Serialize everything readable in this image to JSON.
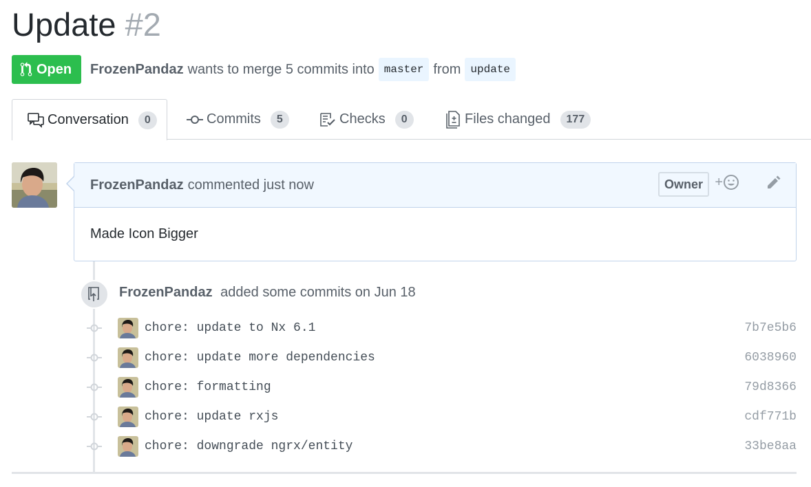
{
  "pr": {
    "title": "Update",
    "number": "#2",
    "state": "Open",
    "author": "FrozenPandaz",
    "wants_to_merge_text": "wants to merge 5 commits into",
    "base_branch": "master",
    "from_text": "from",
    "head_branch": "update"
  },
  "tabs": [
    {
      "label": "Conversation",
      "count": "0",
      "icon": "comment-discussion-icon"
    },
    {
      "label": "Commits",
      "count": "5",
      "icon": "git-commit-icon"
    },
    {
      "label": "Checks",
      "count": "0",
      "icon": "checklist-icon"
    },
    {
      "label": "Files changed",
      "count": "177",
      "icon": "file-diff-icon"
    }
  ],
  "comment": {
    "author": "FrozenPandaz",
    "action_text": "commented just now",
    "role_badge": "Owner",
    "reaction_plus": "+",
    "body": "Made Icon Bigger"
  },
  "commits_event": {
    "author": "FrozenPandaz",
    "text": "added some commits on Jun 18",
    "icon": "repo-push-icon"
  },
  "commits": [
    {
      "message": "chore: update to Nx 6.1",
      "sha": "7b7e5b6"
    },
    {
      "message": "chore: update more dependencies",
      "sha": "6038960"
    },
    {
      "message": "chore: formatting",
      "sha": "79d8366"
    },
    {
      "message": "chore: update rxjs",
      "sha": "cdf771b"
    },
    {
      "message": "chore: downgrade ngrx/entity",
      "sha": "33be8aa"
    }
  ],
  "colors": {
    "open_green": "#2cbe4e",
    "branch_bg": "#eaf5ff",
    "comment_header_bg": "#f1f8ff",
    "comment_border": "#c0d3eb"
  }
}
